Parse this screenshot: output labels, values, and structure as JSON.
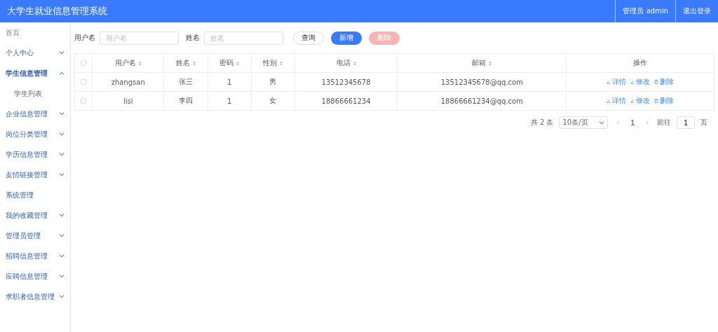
{
  "header": {
    "title": "大学生就业信息管理系统",
    "user": "管理员 admin",
    "logout": "退出登录"
  },
  "sidebar": {
    "items": [
      {
        "label": "首页",
        "kind": "link"
      },
      {
        "label": "个人中心",
        "kind": "group",
        "expanded": false
      },
      {
        "label": "学生信息管理",
        "kind": "group",
        "expanded": true,
        "children": [
          {
            "label": "学生列表"
          }
        ]
      },
      {
        "label": "企业信息管理",
        "kind": "group",
        "expanded": false
      },
      {
        "label": "岗位分类管理",
        "kind": "group",
        "expanded": false
      },
      {
        "label": "学历信息管理",
        "kind": "group",
        "expanded": false
      },
      {
        "label": "友情链接管理",
        "kind": "group",
        "expanded": false
      },
      {
        "label": "系统管理",
        "kind": "link"
      },
      {
        "label": "我的收藏管理",
        "kind": "group",
        "expanded": false
      },
      {
        "label": "管理员管理",
        "kind": "group",
        "expanded": false
      },
      {
        "label": "招聘信息管理",
        "kind": "group",
        "expanded": false
      },
      {
        "label": "应聘信息管理",
        "kind": "group",
        "expanded": false
      },
      {
        "label": "求职者信息管理",
        "kind": "group",
        "expanded": false
      }
    ]
  },
  "search": {
    "fields": [
      {
        "label": "用户名",
        "placeholder": "用户名"
      },
      {
        "label": "姓名",
        "placeholder": "姓名"
      }
    ],
    "buttons": [
      {
        "label": "查询",
        "kind": "plain",
        "disabled": false
      },
      {
        "label": "新增",
        "kind": "primary",
        "disabled": false
      },
      {
        "label": "删除",
        "kind": "danger",
        "disabled": true
      }
    ]
  },
  "table": {
    "all_checked": false,
    "columns": [
      {
        "label": "用户名",
        "sortable": true
      },
      {
        "label": "姓名",
        "sortable": true
      },
      {
        "label": "密码",
        "sortable": true
      },
      {
        "label": "性别",
        "sortable": true
      },
      {
        "label": "电话",
        "sortable": true
      },
      {
        "label": "邮箱",
        "sortable": true
      },
      {
        "label": "操作",
        "sortable": false
      }
    ],
    "rows": [
      {
        "checked": false,
        "cells": [
          "zhangsan",
          "张三",
          "1",
          "男",
          "13512345678",
          "13512345678@qq.com"
        ],
        "actions": [
          "详情",
          "修改",
          "删除"
        ]
      },
      {
        "checked": false,
        "cells": [
          "lisi",
          "李四",
          "1",
          "女",
          "18866661234",
          "18866661234@qq.com"
        ],
        "actions": [
          "详情",
          "修改",
          "删除"
        ]
      }
    ]
  },
  "pagination": {
    "total": "共 2 条",
    "page_size": "10条/页",
    "pages": [
      {
        "label": "1",
        "selected": true
      }
    ],
    "goto_label": "前往",
    "goto_value": "1",
    "goto_unit": "页"
  }
}
